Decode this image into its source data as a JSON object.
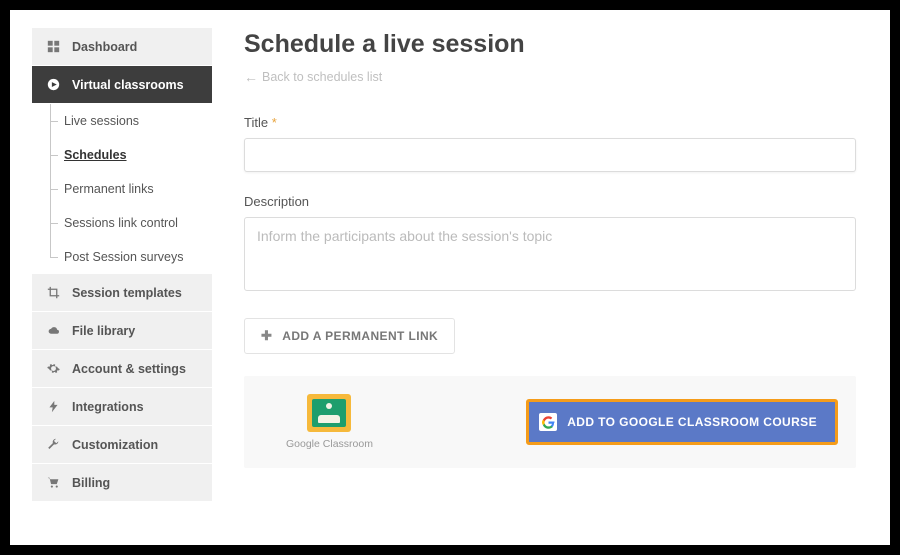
{
  "sidebar": {
    "items": [
      {
        "label": "Dashboard"
      },
      {
        "label": "Virtual classrooms"
      },
      {
        "label": "Session templates"
      },
      {
        "label": "File library"
      },
      {
        "label": "Account & settings"
      },
      {
        "label": "Integrations"
      },
      {
        "label": "Customization"
      },
      {
        "label": "Billing"
      }
    ],
    "virtual_sub": [
      {
        "label": "Live sessions"
      },
      {
        "label": "Schedules"
      },
      {
        "label": "Permanent links"
      },
      {
        "label": "Sessions link control"
      },
      {
        "label": "Post Session surveys"
      }
    ]
  },
  "main": {
    "title": "Schedule a live session",
    "back_link": "Back to schedules list",
    "form": {
      "title_label": "Title",
      "title_required_mark": "*",
      "title_value": "",
      "description_label": "Description",
      "description_placeholder": "Inform the participants about the session's topic",
      "description_value": ""
    },
    "add_permanent_link_label": "ADD A PERMANENT LINK",
    "google_classroom": {
      "caption": "Google Classroom",
      "button_label": "ADD TO GOOGLE CLASSROOM COURSE"
    }
  },
  "icons": {
    "dashboard": "dashboard-icon",
    "virtual": "play-circle-icon",
    "templates": "crop-icon",
    "files": "cloud-icon",
    "settings": "gear-icon",
    "integrations": "bolt-icon",
    "customization": "wrench-icon",
    "billing": "cart-icon"
  }
}
